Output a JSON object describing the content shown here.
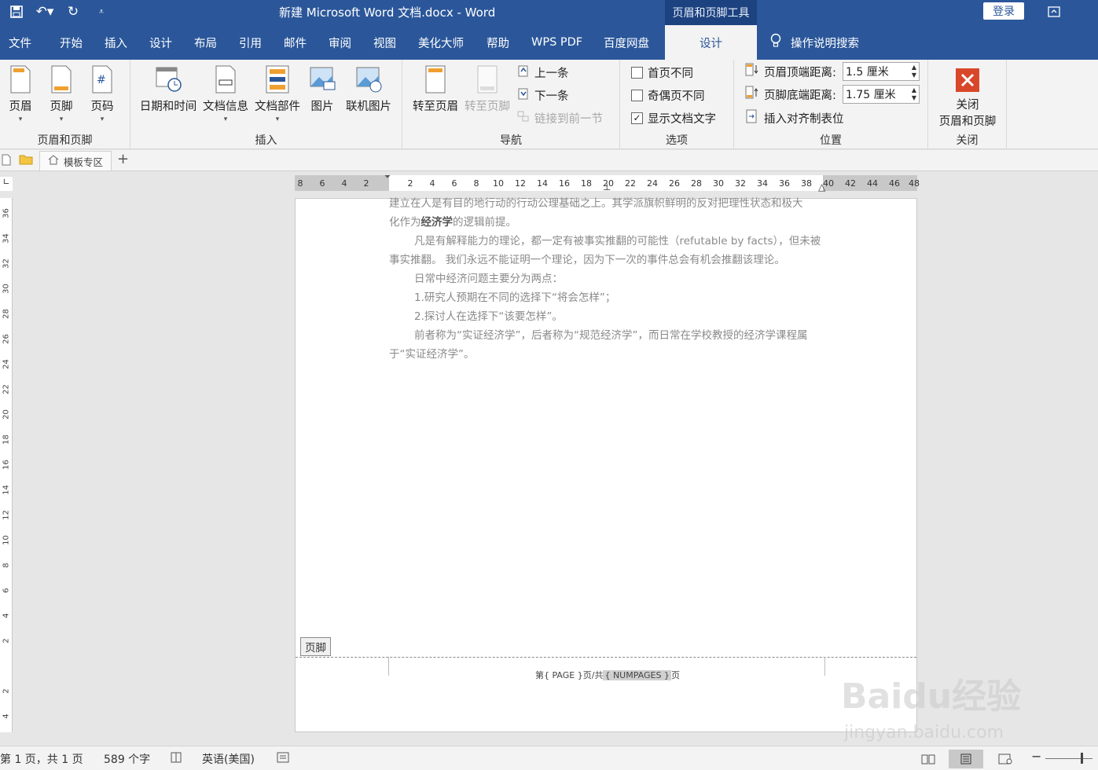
{
  "titlebar": {
    "doc_title": "新建 Microsoft Word 文档.docx  -  Word",
    "context_tools": "页眉和页脚工具",
    "login": "登录"
  },
  "tabs": [
    "文件",
    "开始",
    "插入",
    "设计",
    "布局",
    "引用",
    "邮件",
    "审阅",
    "视图",
    "美化大师",
    "帮助",
    "WPS PDF",
    "百度网盘"
  ],
  "active_tab": "设计",
  "tell_me": "操作说明搜索",
  "ribbon": {
    "hf_group": {
      "label": "页眉和页脚",
      "header": "页眉",
      "footer": "页脚",
      "page_number": "页码"
    },
    "insert_group": {
      "label": "插入",
      "datetime": "日期和时间",
      "docinfo": "文档信息",
      "quickparts": "文档部件",
      "picture": "图片",
      "online_picture": "联机图片"
    },
    "nav_group": {
      "label": "导航",
      "goto_header": "转至页眉",
      "goto_footer": "转至页脚",
      "previous": "上一条",
      "next": "下一条",
      "link_previous": "链接到前一节"
    },
    "options_group": {
      "label": "选项",
      "diff_first": "首页不同",
      "diff_odd_even": "奇偶页不同",
      "show_text": "显示文档文字",
      "show_text_checked": "✓"
    },
    "position_group": {
      "label": "位置",
      "header_top_label": "页眉顶端距离:",
      "header_top_value": "1.5 厘米",
      "footer_bottom_label": "页脚底端距离:",
      "footer_bottom_value": "1.75 厘米",
      "insert_align_tab": "插入对齐制表位"
    },
    "close_group": {
      "label": "关闭",
      "close_line1": "关闭",
      "close_line2": "页眉和页脚"
    }
  },
  "docbar": {
    "template_tab": "模板专区",
    "add": "+"
  },
  "hruler_labels": [
    "8",
    "6",
    "4",
    "2",
    "2",
    "4",
    "6",
    "8",
    "10",
    "12",
    "14",
    "16",
    "18",
    "20",
    "22",
    "24",
    "26",
    "28",
    "30",
    "32",
    "34",
    "36",
    "38",
    "40",
    "42",
    "44",
    "46",
    "48"
  ],
  "vruler_labels": [
    "36",
    "34",
    "32",
    "30",
    "28",
    "26",
    "24",
    "22",
    "20",
    "18",
    "16",
    "14",
    "12",
    "10",
    "8",
    "6",
    "4",
    "2",
    "",
    "2",
    "4"
  ],
  "body": {
    "line1": "建立在人是有目的地行动的行动公理基础之上。其学派旗帜鲜明的反对把理性状态和极大",
    "line2_a": "化作为",
    "line2_bold": "经济学",
    "line2_b": "的逻辑前提。",
    "para2": "凡是有解释能力的理论，都一定有被事实推翻的可能性（refutable by facts），但未被事实推翻。 我们永远不能证明一个理论，因为下一次的事件总会有机会推翻该理论。",
    "para3": "日常中经济问题主要分为两点：",
    "para4": "1.研究人预期在不同的选择下“将会怎样”；",
    "para5": "2.探讨人在选择下“该要怎样”。",
    "para6": "前者称为“实证经济学”，后者称为“规范经济学”，而日常在学校教授的经济学课程属于“实证经济学”。"
  },
  "footer": {
    "label": "页脚",
    "t1": "第",
    "f1": "{ PAGE }",
    "t2": "页/共",
    "f2": "{ NUMPAGES }",
    "t3": "页"
  },
  "status": {
    "page": "第 1 页，共 1 页",
    "words": "589 个字",
    "lang": "英语(美国)"
  },
  "watermark": {
    "brand": "Baidu经验",
    "url": "jingyan.baidu.com"
  }
}
